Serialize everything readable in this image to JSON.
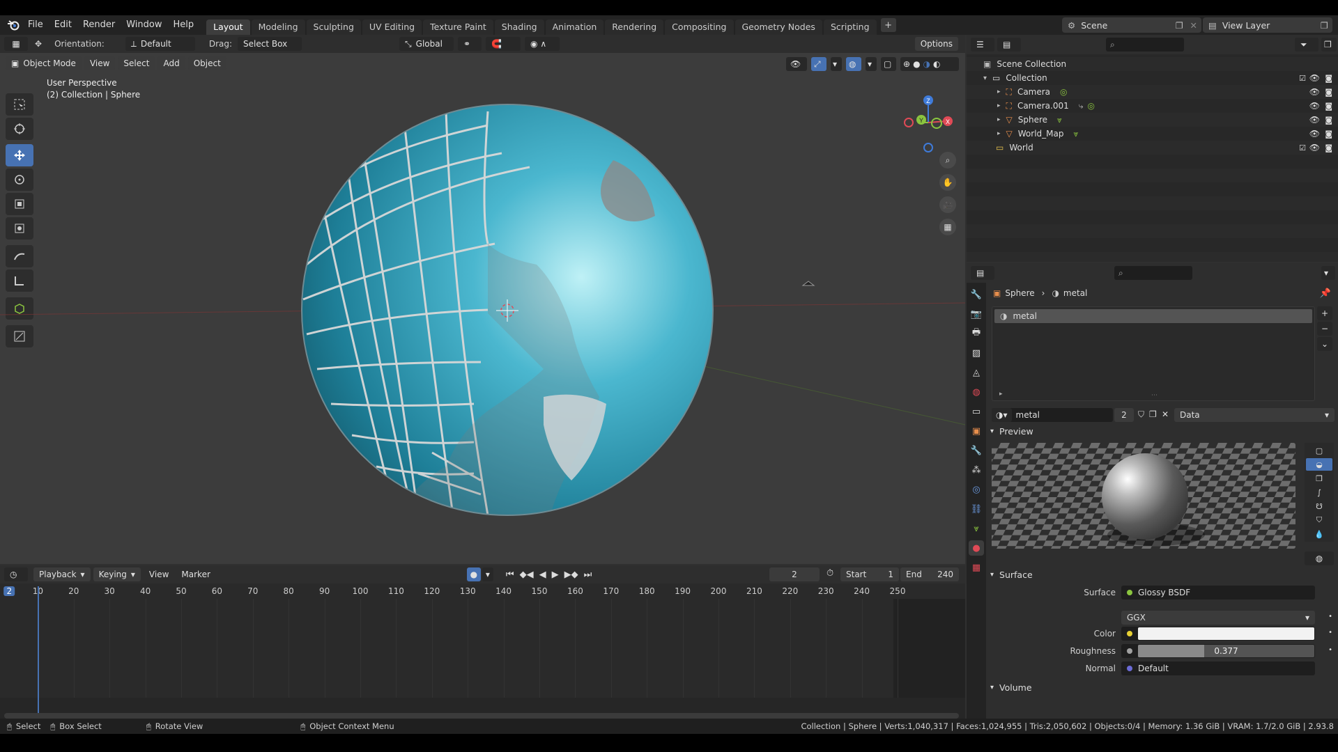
{
  "menu": {
    "items": [
      "File",
      "Edit",
      "Render",
      "Window",
      "Help"
    ]
  },
  "workspaces": [
    "Layout",
    "Modeling",
    "Sculpting",
    "UV Editing",
    "Texture Paint",
    "Shading",
    "Animation",
    "Rendering",
    "Compositing",
    "Geometry Nodes",
    "Scripting"
  ],
  "scene": {
    "name": "Scene",
    "view_layer": "View Layer"
  },
  "viewport": {
    "orientation_label": "Orientation:",
    "orientation_value": "Default",
    "drag_label": "Drag:",
    "drag_value": "Select Box",
    "transform_space": "Global",
    "options_label": "Options",
    "mode": "Object Mode",
    "menu": [
      "View",
      "Select",
      "Add",
      "Object"
    ],
    "info_line1": "User Perspective",
    "info_line2": "(2) Collection | Sphere",
    "gizmo_labels": {
      "z": "Z",
      "y": "Y",
      "x": "X"
    }
  },
  "timeline": {
    "menu": [
      "Playback",
      "Keying",
      "View",
      "Marker"
    ],
    "current_frame": "2",
    "start_label": "Start",
    "start_value": "1",
    "end_label": "End",
    "end_value": "240",
    "ruler": [
      "2",
      "10",
      "20",
      "30",
      "40",
      "50",
      "60",
      "70",
      "80",
      "90",
      "100",
      "110",
      "120",
      "130",
      "140",
      "150",
      "160",
      "170",
      "180",
      "190",
      "200",
      "210",
      "220",
      "230",
      "240",
      "250"
    ]
  },
  "status": {
    "select": "Select",
    "box_select": "Box Select",
    "rotate_view": "Rotate View",
    "context_menu": "Object Context Menu",
    "stats": "Collection | Sphere | Verts:1,040,317 | Faces:1,024,955 | Tris:2,050,602 | Objects:0/4 | Memory: 1.36 GiB | VRAM: 1.7/2.0 GiB | 2.93.8"
  },
  "outliner": {
    "root": "Scene Collection",
    "collection": "Collection",
    "objects": [
      "Camera",
      "Camera.001",
      "Sphere",
      "World_Map"
    ],
    "world": "World"
  },
  "properties": {
    "breadcrumb_object": "Sphere",
    "breadcrumb_material": "metal",
    "slot_name": "metal",
    "material_name": "metal",
    "users": "2",
    "link": "Data",
    "preview_title": "Preview",
    "surface_title": "Surface",
    "surface_label": "Surface",
    "surface_value": "Glossy BSDF",
    "distribution": "GGX",
    "color_label": "Color",
    "roughness_label": "Roughness",
    "roughness_value": "0.377",
    "roughness_fraction": 0.377,
    "normal_label": "Normal",
    "normal_value": "Default",
    "volume_title": "Volume"
  },
  "colors": {
    "accent": "#4772b3",
    "ocean": "#2a8ea8",
    "x_axis": "#e04a56",
    "y_axis": "#8bc53f",
    "z_axis": "#3f7bd9"
  }
}
